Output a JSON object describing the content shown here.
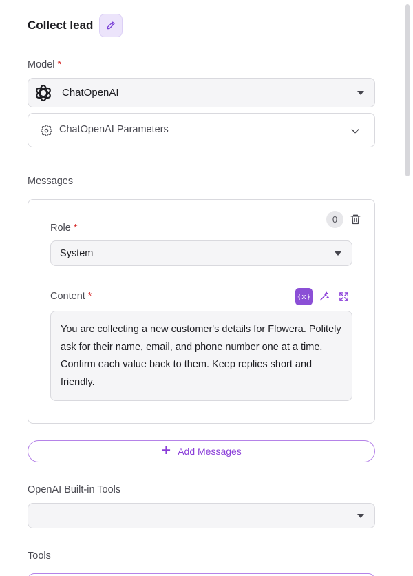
{
  "header": {
    "title": "Collect lead"
  },
  "model": {
    "label": "Model",
    "required_mark": "*",
    "value": "ChatOpenAI"
  },
  "params": {
    "label": "ChatOpenAI Parameters"
  },
  "messages": {
    "label": "Messages",
    "count": "0",
    "role": {
      "label": "Role",
      "required_mark": "*",
      "value": "System"
    },
    "content": {
      "label": "Content",
      "required_mark": "*",
      "variable_button": "{x}",
      "value": "You are collecting a new customer's details for Flowera. Politely ask for their name, email, and phone number one at a time. Confirm each value back to them. Keep replies short and friendly."
    },
    "add_button": "Add Messages"
  },
  "builtin_tools": {
    "label": "OpenAI Built-in Tools",
    "value": ""
  },
  "tools": {
    "label": "Tools"
  },
  "colors": {
    "accent": "#8b3fd9",
    "accent_soft": "#ece4fb",
    "required": "#d52a2a"
  },
  "icons": {
    "edit": "pencil-icon",
    "model": "openai-logo-icon",
    "settings": "gear-icon",
    "expand": "chevron-down-icon",
    "delete": "trash-icon",
    "variable": "variable-icon",
    "magic": "magic-wand-icon",
    "fullscreen": "expand-icon",
    "add": "plus-icon"
  }
}
